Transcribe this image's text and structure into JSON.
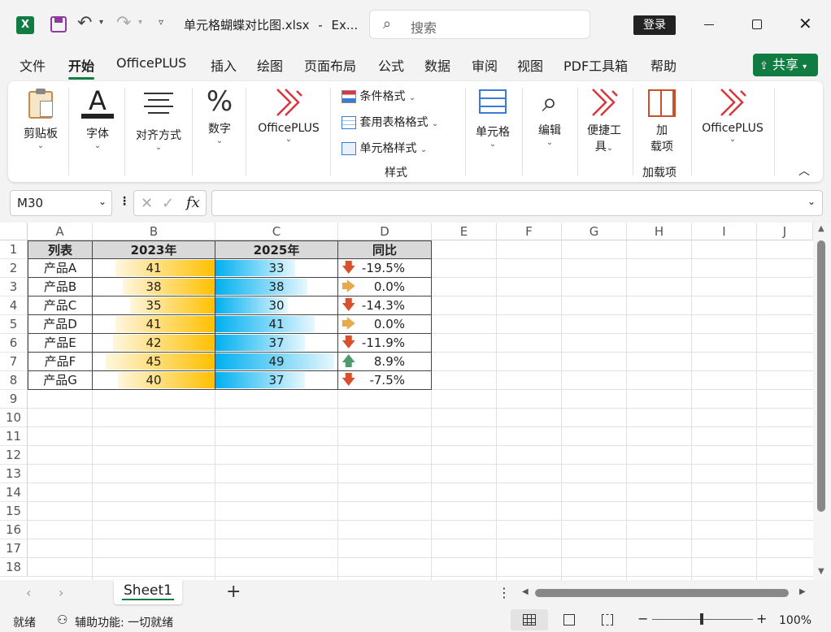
{
  "title": {
    "filename": "单元格蝴蝶对比图.xlsx",
    "sep": "-",
    "app": "Ex...",
    "search": "搜索",
    "login": "登录"
  },
  "tabs": [
    "文件",
    "开始",
    "OfficePLUS",
    "插入",
    "绘图",
    "页面布局",
    "公式",
    "数据",
    "审阅",
    "视图",
    "PDF工具箱",
    "帮助"
  ],
  "share": "共享",
  "ribbon": {
    "clipboard": "剪贴板",
    "font": "字体",
    "align": "对齐方式",
    "number": "数字",
    "officeplus1": "OfficePLUS",
    "cond": "条件格式",
    "tablefmt": "套用表格格式",
    "cellstyle": "单元格样式",
    "styles_group": "样式",
    "cells": "单元格",
    "edit": "编辑",
    "tools1": "便捷工",
    "tools2": "具",
    "addin1": "加",
    "addin2": "载项",
    "addin_group": "加载项",
    "officeplus2": "OfficePLUS"
  },
  "formula": {
    "namebox": "M30",
    "value": ""
  },
  "columns": [
    "A",
    "B",
    "C",
    "D",
    "E",
    "F",
    "G",
    "H",
    "I",
    "J"
  ],
  "rows": [
    "1",
    "2",
    "3",
    "4",
    "5",
    "6",
    "7",
    "8",
    "9",
    "10",
    "11",
    "12",
    "13",
    "14",
    "15",
    "16",
    "17",
    "18"
  ],
  "header": {
    "a": "列表",
    "b": "2023年",
    "c": "2025年",
    "d": "同比"
  },
  "data": [
    {
      "name": "产品A",
      "v2023": 41,
      "v2025": 33,
      "yoy": "-19.5%",
      "dir": "down"
    },
    {
      "name": "产品B",
      "v2023": 38,
      "v2025": 38,
      "yoy": "0.0%",
      "dir": "flat"
    },
    {
      "name": "产品C",
      "v2023": 35,
      "v2025": 30,
      "yoy": "-14.3%",
      "dir": "down"
    },
    {
      "name": "产品D",
      "v2023": 41,
      "v2025": 41,
      "yoy": "0.0%",
      "dir": "flat"
    },
    {
      "name": "产品E",
      "v2023": 42,
      "v2025": 37,
      "yoy": "-11.9%",
      "dir": "down"
    },
    {
      "name": "产品F",
      "v2023": 45,
      "v2025": 49,
      "yoy": "8.9%",
      "dir": "up"
    },
    {
      "name": "产品G",
      "v2023": 40,
      "v2025": 37,
      "yoy": "-7.5%",
      "dir": "down"
    }
  ],
  "bar_max": 50,
  "colors": {
    "bar2023": "#ffc000",
    "bar2025": "#00b0f0",
    "down": "#d9512c",
    "flat": "#e7a94b",
    "up": "#4e9a6a",
    "excel": "#107c41"
  },
  "sheet": {
    "name": "Sheet1",
    "add": "+"
  },
  "status": {
    "ready": "就绪",
    "access": "辅助功能: 一切就绪",
    "zoom": "100%",
    "zoom_level": 1.0
  }
}
